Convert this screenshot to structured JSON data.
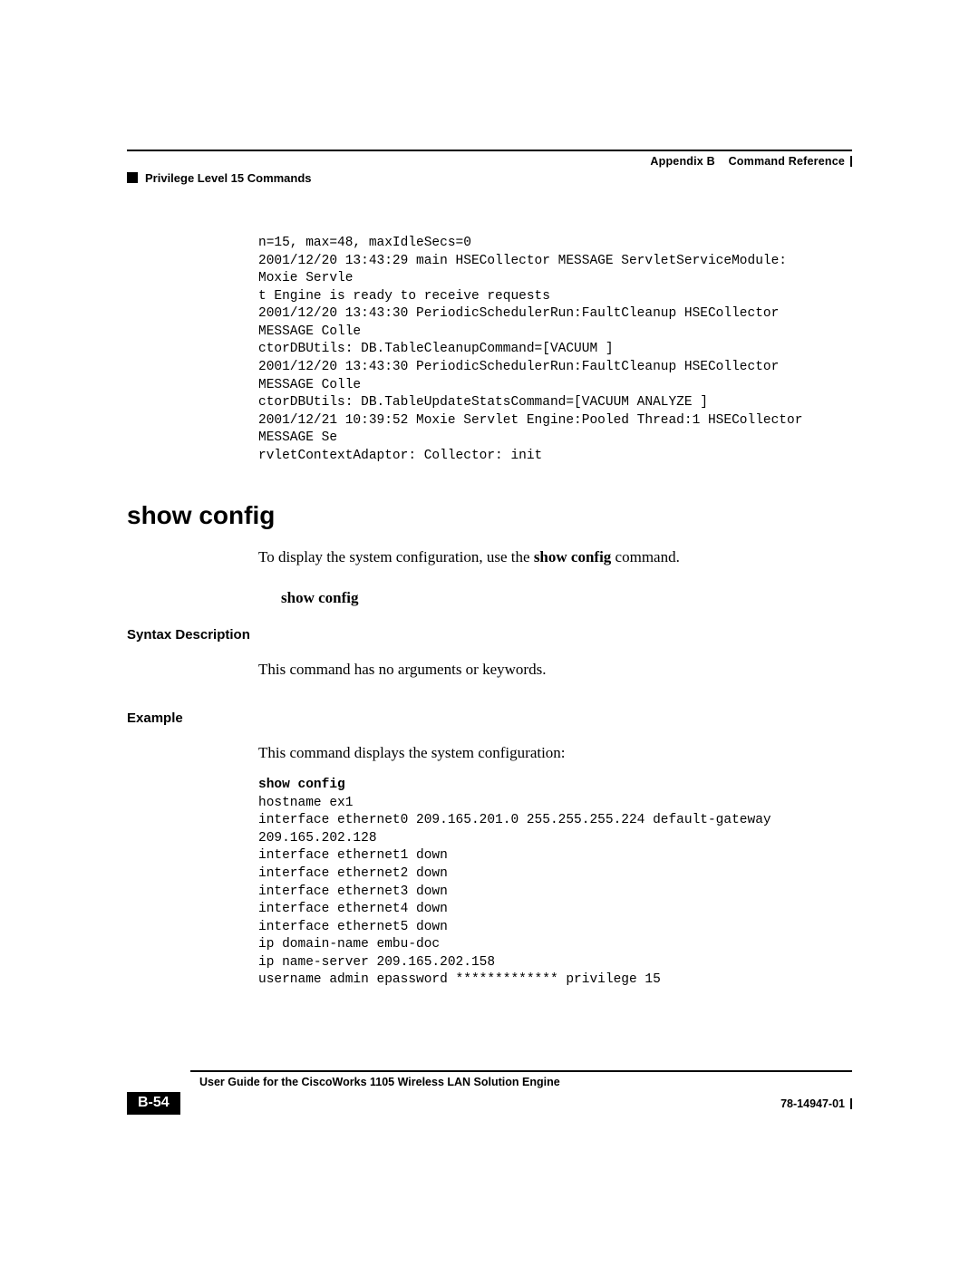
{
  "header": {
    "appendix": "Appendix B",
    "appendix_title": "Command Reference",
    "section": "Privilege Level 15 Commands"
  },
  "log_block": "n=15, max=48, maxIdleSecs=0\n2001/12/20 13:43:29 main HSECollector MESSAGE ServletServiceModule:\nMoxie Servle\nt Engine is ready to receive requests\n2001/12/20 13:43:30 PeriodicSchedulerRun:FaultCleanup HSECollector\nMESSAGE Colle\nctorDBUtils: DB.TableCleanupCommand=[VACUUM ]\n2001/12/20 13:43:30 PeriodicSchedulerRun:FaultCleanup HSECollector\nMESSAGE Colle\nctorDBUtils: DB.TableUpdateStatsCommand=[VACUUM ANALYZE ]\n2001/12/21 10:39:52 Moxie Servlet Engine:Pooled Thread:1 HSECollector\nMESSAGE Se\nrvletContextAdaptor: Collector: init",
  "command": {
    "title": "show config",
    "desc_pre": "To display the system configuration, use the ",
    "desc_cmd": "show config",
    "desc_post": " command.",
    "syntax": "show config"
  },
  "sections": {
    "syntax_label": "Syntax Description",
    "syntax_text": "This command has no arguments or keywords.",
    "example_label": "Example",
    "example_intro": "This command displays the system configuration:"
  },
  "example_output": {
    "cmd": "show config",
    "body": "hostname ex1\ninterface ethernet0 209.165.201.0 255.255.255.224 default-gateway\n209.165.202.128\ninterface ethernet1 down\ninterface ethernet2 down\ninterface ethernet3 down\ninterface ethernet4 down\ninterface ethernet5 down\nip domain-name embu-doc\nip name-server 209.165.202.158\nusername admin epassword ************* privilege 15"
  },
  "footer": {
    "guide": "User Guide for the CiscoWorks 1105 Wireless LAN Solution Engine",
    "page": "B-54",
    "docnum": "78-14947-01"
  }
}
